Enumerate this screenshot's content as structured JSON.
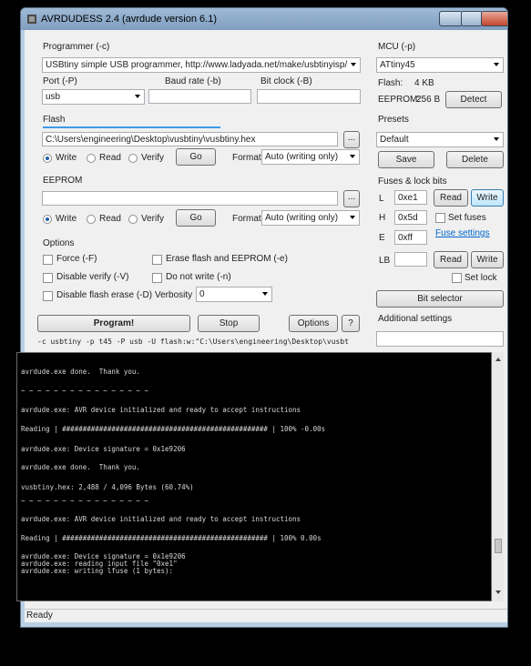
{
  "window": {
    "title": "AVRDUDESS 2.4 (avrdude version 6.1)"
  },
  "programmer": {
    "group_label": "Programmer (-c)",
    "selected": "USBtiny simple USB programmer, http://www.ladyada.net/make/usbtinyisp/",
    "port_label": "Port (-P)",
    "port_value": "usb",
    "baud_label": "Baud rate (-b)",
    "baud_value": "",
    "bitclock_label": "Bit clock (-B)",
    "bitclock_value": ""
  },
  "mcu": {
    "group_label": "MCU (-p)",
    "selected": "ATtiny45",
    "flash_label": "Flash:",
    "flash_value": "4 KB",
    "eeprom_label": "EEPROM:",
    "eeprom_value": "256 B",
    "detect_label": "Detect"
  },
  "flash": {
    "group_label": "Flash",
    "path": "C:\\Users\\engineering\\Desktop\\vusbtiny\\vusbtiny.hex",
    "browse_label": "...",
    "write_label": "Write",
    "read_label": "Read",
    "verify_label": "Verify",
    "go_label": "Go",
    "format_label": "Format",
    "format_value": "Auto (writing only)",
    "selected_mode": "write"
  },
  "eeprom": {
    "group_label": "EEPROM",
    "path": "",
    "browse_label": "...",
    "write_label": "Write",
    "read_label": "Read",
    "verify_label": "Verify",
    "go_label": "Go",
    "format_label": "Format",
    "format_value": "Auto (writing only)",
    "selected_mode": "write"
  },
  "presets": {
    "group_label": "Presets",
    "selected": "Default",
    "save_label": "Save",
    "delete_label": "Delete"
  },
  "fuses": {
    "group_label": "Fuses & lock bits",
    "l_label": "L",
    "l_value": "0xe1",
    "h_label": "H",
    "h_value": "0x5d",
    "e_label": "E",
    "e_value": "0xff",
    "lb_label": "LB",
    "lb_value": "",
    "read_label": "Read",
    "write_label": "Write",
    "set_fuses_label": "Set fuses",
    "fuse_settings_link": "Fuse settings",
    "set_lock_label": "Set lock",
    "bit_selector_label": "Bit selector"
  },
  "options": {
    "group_label": "Options",
    "force_label": "Force (-F)",
    "erase_label": "Erase flash and EEPROM (-e)",
    "disable_verify_label": "Disable verify (-V)",
    "do_not_write_label": "Do not write (-n)",
    "disable_flash_erase_label": "Disable flash erase (-D)",
    "verbosity_label": "Verbosity",
    "verbosity_value": "0"
  },
  "actions": {
    "program_label": "Program!",
    "stop_label": "Stop",
    "options_label": "Options",
    "help_label": "?"
  },
  "additional": {
    "group_label": "Additional settings",
    "value": ""
  },
  "command_line": "-c usbtiny -p t45 -P usb -U flash:w:\"C:\\Users\\engineering\\Desktop\\vusbt",
  "console_lines": [
    "avrdude.exe done.  Thank you.",
    "~ ~ ~ ~ ~ ~ ~ ~ ~ ~ ~ ~ ~ ~ ~ ~",
    "avrdude.exe: AVR device initialized and ready to accept instructions",
    "Reading | ################################################## | 100% -0.00s",
    "avrdude.exe: Device signature = 0x1e9206",
    "avrdude.exe done.  Thank you.",
    "vusbtiny.hex: 2,488 / 4,096 Bytes (60.74%)",
    "~ ~ ~ ~ ~ ~ ~ ~ ~ ~ ~ ~ ~ ~ ~ ~",
    "avrdude.exe: AVR device initialized and ready to accept instructions",
    "Reading | ################################################## | 100% 0.00s",
    "avrdude.exe: Device signature = 0x1e9206",
    "avrdude.exe: reading input file \"0xe1\"",
    "avrdude.exe: writing lfuse (1 bytes):"
  ],
  "status": "Ready",
  "colors": {
    "accent": "#3c7fb1",
    "console_bg": "#000000",
    "link": "#0066cc"
  }
}
